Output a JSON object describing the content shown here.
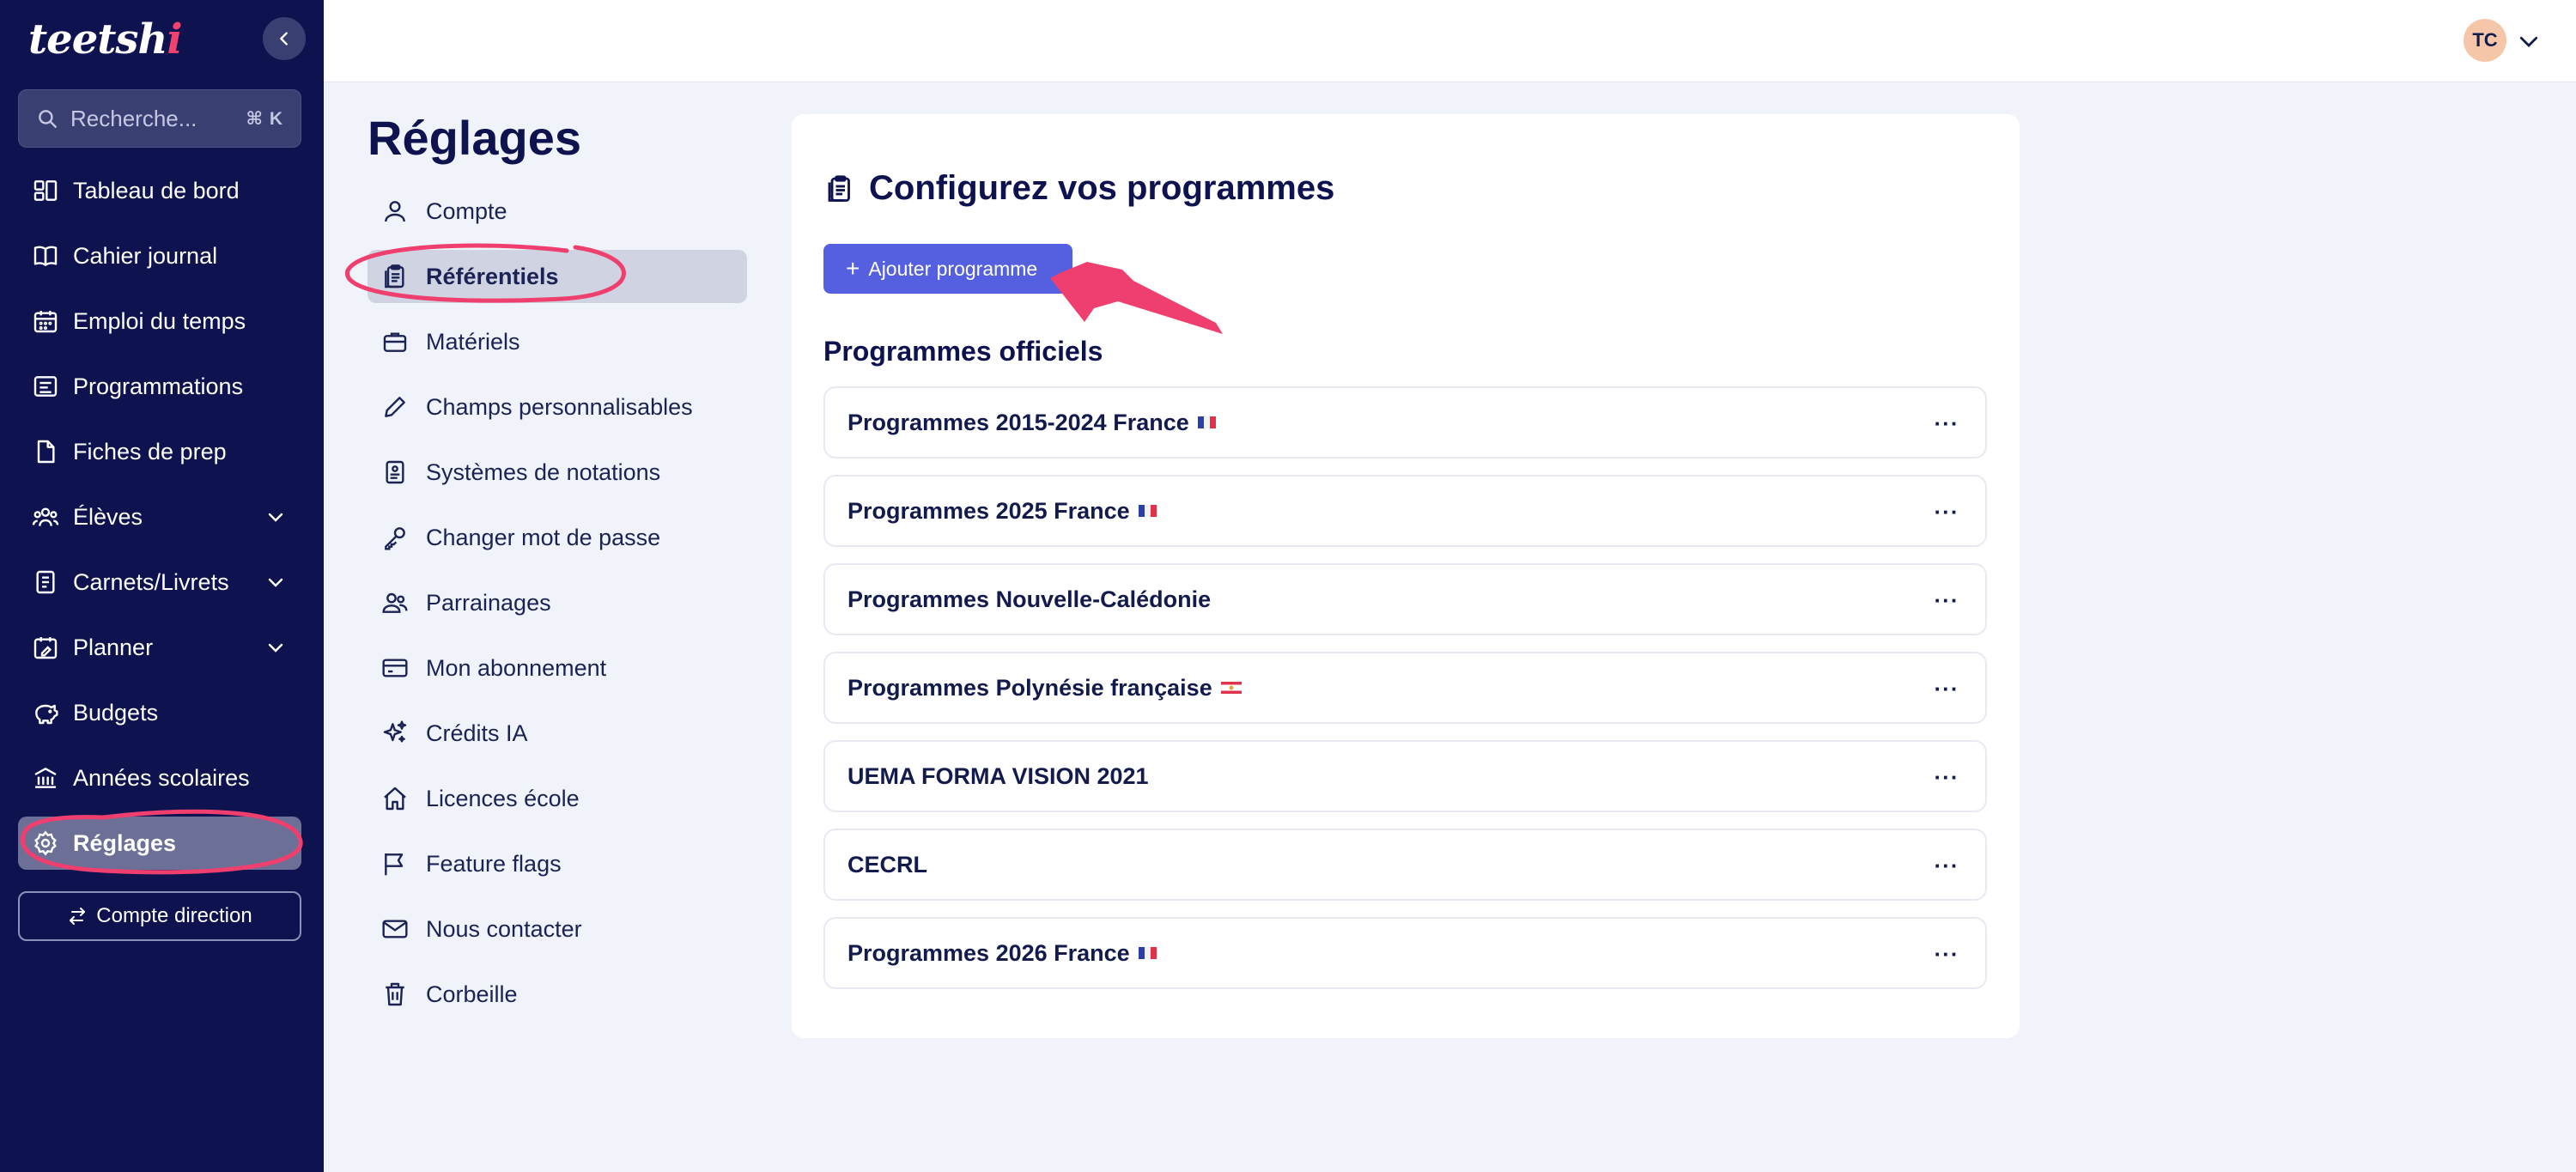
{
  "app": {
    "logo_main": "teetsh",
    "logo_accent": "i"
  },
  "sidebar": {
    "search_placeholder": "Recherche...",
    "search_shortcut": "⌘ K",
    "items": [
      {
        "label": "Tableau de bord",
        "icon": "dashboard-icon"
      },
      {
        "label": "Cahier journal",
        "icon": "book-icon"
      },
      {
        "label": "Emploi du temps",
        "icon": "calendar-icon"
      },
      {
        "label": "Programmations",
        "icon": "list-icon"
      },
      {
        "label": "Fiches de prep",
        "icon": "file-icon"
      },
      {
        "label": "Élèves",
        "icon": "students-icon",
        "expandable": true
      },
      {
        "label": "Carnets/Livrets",
        "icon": "notebook-icon",
        "expandable": true
      },
      {
        "label": "Planner",
        "icon": "planner-icon",
        "expandable": true
      },
      {
        "label": "Budgets",
        "icon": "piggy-bank-icon"
      },
      {
        "label": "Années scolaires",
        "icon": "school-icon"
      },
      {
        "label": "Réglages",
        "icon": "gear-icon",
        "active": true
      }
    ],
    "direction_button": "Compte direction"
  },
  "topbar": {
    "avatar_initials": "TC"
  },
  "settings": {
    "title": "Réglages",
    "items": [
      {
        "label": "Compte",
        "icon": "user-icon"
      },
      {
        "label": "Référentiels",
        "icon": "clipboard-icon",
        "active": true
      },
      {
        "label": "Matériels",
        "icon": "briefcase-icon"
      },
      {
        "label": "Champs personnalisables",
        "icon": "pencil-icon"
      },
      {
        "label": "Systèmes de notations",
        "icon": "grading-icon"
      },
      {
        "label": "Changer mot de passe",
        "icon": "key-icon"
      },
      {
        "label": "Parrainages",
        "icon": "referral-icon"
      },
      {
        "label": "Mon abonnement",
        "icon": "credit-card-icon"
      },
      {
        "label": "Crédits IA",
        "icon": "sparkles-icon"
      },
      {
        "label": "Licences école",
        "icon": "home-icon"
      },
      {
        "label": "Feature flags",
        "icon": "flag-icon"
      },
      {
        "label": "Nous contacter",
        "icon": "mail-icon"
      },
      {
        "label": "Corbeille",
        "icon": "trash-icon"
      }
    ]
  },
  "main": {
    "title": "Configurez vos programmes",
    "add_button": "Ajouter programme",
    "section_title": "Programmes officiels",
    "programs": [
      {
        "name": "Programmes 2015-2024 France",
        "flag": "france"
      },
      {
        "name": "Programmes 2025 France",
        "flag": "france"
      },
      {
        "name": "Programmes Nouvelle-Calédonie",
        "flag": ""
      },
      {
        "name": "Programmes Polynésie française",
        "flag": "polynesia"
      },
      {
        "name": "UEMA FORMA VISION 2021",
        "flag": ""
      },
      {
        "name": "CECRL",
        "flag": ""
      },
      {
        "name": "Programmes 2026 France",
        "flag": "france"
      }
    ],
    "more_symbol": "···"
  },
  "colors": {
    "sidebar_bg": "#0e1350",
    "primary_button": "#5560e0",
    "annotation": "#ef3f6f",
    "active_settings_item": "#d0d4e2"
  }
}
